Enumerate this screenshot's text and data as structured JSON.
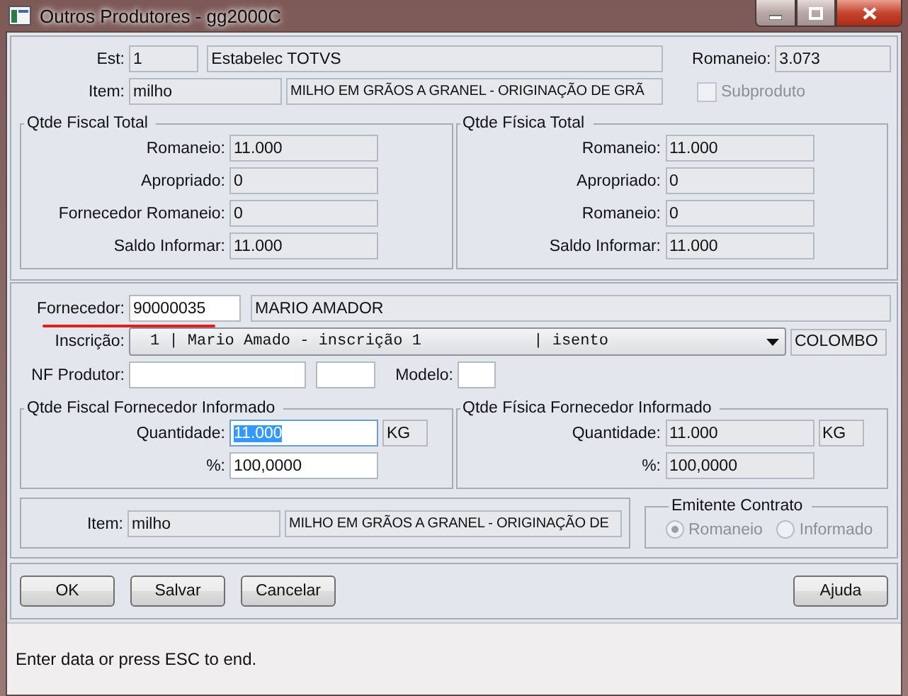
{
  "window": {
    "title": "Outros Produtores - gg2000C"
  },
  "header": {
    "est": {
      "label": "Est:",
      "code": "1",
      "name": "Estabelec TOTVS"
    },
    "romaneio": {
      "label": "Romaneio:",
      "value": "3.073"
    },
    "item": {
      "label": "Item:",
      "code": "milho",
      "name": "MILHO EM GRÃOS A GRANEL - ORIGINAÇÃO DE GRÃ"
    },
    "subproduto": {
      "label": "Subproduto",
      "checked": false,
      "disabled": true
    }
  },
  "totals": [
    {
      "title": "Qtde Fiscal Total",
      "rows": [
        {
          "label": "Romaneio:",
          "value": "11.000"
        },
        {
          "label": "Apropriado:",
          "value": "0"
        },
        {
          "label": "Fornecedor Romaneio:",
          "value": "0"
        },
        {
          "label": "Saldo Informar:",
          "value": "11.000"
        }
      ]
    },
    {
      "title": "Qtde Física Total",
      "rows": [
        {
          "label": "Romaneio:",
          "value": "11.000"
        },
        {
          "label": "Apropriado:",
          "value": "0"
        },
        {
          "label": "Romaneio:",
          "value": "0"
        },
        {
          "label": "Saldo Informar:",
          "value": "11.000"
        }
      ]
    }
  ],
  "supplier": {
    "fornecedor": {
      "label": "Fornecedor:",
      "code": "90000035",
      "name": "MARIO AMADOR",
      "underlined": true
    },
    "inscricao": {
      "label": "Inscrição:",
      "value": "1 | Mario Amado - inscrição 1            | isento",
      "city": "COLOMBO"
    },
    "nf_produtor": {
      "label": "NF Produtor:"
    },
    "modelo": {
      "label": "Modelo:"
    }
  },
  "informed": [
    {
      "title": "Qtde Fiscal Fornecedor Informado",
      "editable": true,
      "quantity": {
        "label": "Quantidade:",
        "value": "11.000",
        "selected": true
      },
      "unit": "KG",
      "percent": {
        "label": "%:",
        "value": "100,0000"
      }
    },
    {
      "title": "Qtde Física Fornecedor Informado",
      "editable": false,
      "quantity": {
        "label": "Quantidade:",
        "value": "11.000",
        "selected": false
      },
      "unit": "KG",
      "percent": {
        "label": "%:",
        "value": "100,0000"
      }
    }
  ],
  "item_bottom": {
    "label": "Item:",
    "code": "milho",
    "name": "MILHO EM GRÃOS A GRANEL - ORIGINAÇÃO DE"
  },
  "emitente": {
    "title": "Emitente Contrato",
    "options": [
      {
        "label": "Romaneio",
        "selected": true,
        "disabled": true
      },
      {
        "label": "Informado",
        "selected": false,
        "disabled": true
      }
    ]
  },
  "buttons_left": [
    "OK",
    "Salvar",
    "Cancelar"
  ],
  "buttons_right": [
    "Ajuda"
  ],
  "status_bar": "Enter data or press ESC to end."
}
